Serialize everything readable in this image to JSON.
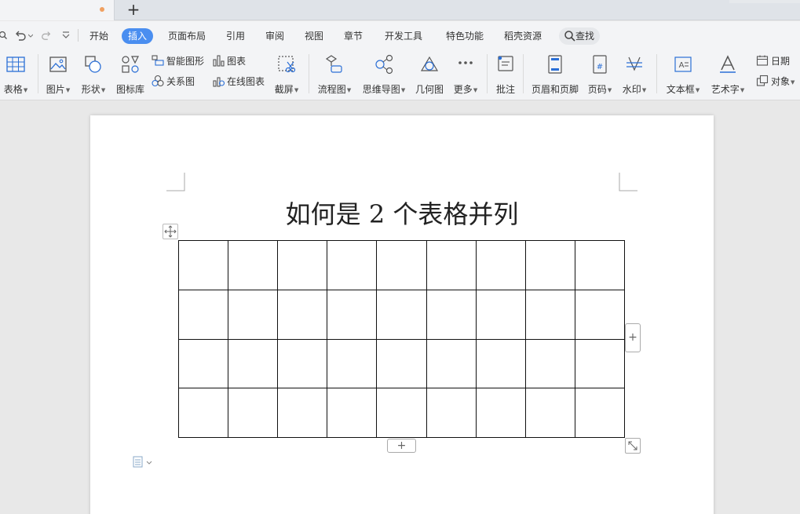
{
  "tabs": {
    "add_label": "+"
  },
  "quick_access": {
    "undo_icon": "undo-icon",
    "redo_icon": "redo-icon",
    "customize_icon": "chevron-down-icon"
  },
  "menu": {
    "items": [
      "开始",
      "插入",
      "页面布局",
      "引用",
      "审阅",
      "视图",
      "章节",
      "开发工具",
      "特色功能",
      "稻壳资源"
    ],
    "active": "插入",
    "find_label": "查找"
  },
  "ribbon": {
    "table": "表格",
    "picture": "图片",
    "shape": "形状",
    "icon_lib": "图标库",
    "smart_art": "智能图形",
    "chart": "图表",
    "relation": "关系图",
    "online_chart": "在线图表",
    "screenshot": "截屏",
    "flowchart": "流程图",
    "mindmap": "思维导图",
    "geometry": "几何图",
    "more": "更多",
    "comment": "批注",
    "header_footer": "页眉和页脚",
    "page_num": "页码",
    "watermark": "水印",
    "textbox": "文本框",
    "wordart": "艺术字",
    "date": "日期",
    "object": "对象"
  },
  "document": {
    "title": "如何是 2 个表格并列",
    "table": {
      "rows": 4,
      "cols": 9
    },
    "add_col_label": "+",
    "add_row_label": "+"
  },
  "colors": {
    "accent": "#4a8ef0",
    "icon_blue": "#2b6fd6",
    "page": "#ffffff",
    "workspace": "#e8e8e8"
  }
}
